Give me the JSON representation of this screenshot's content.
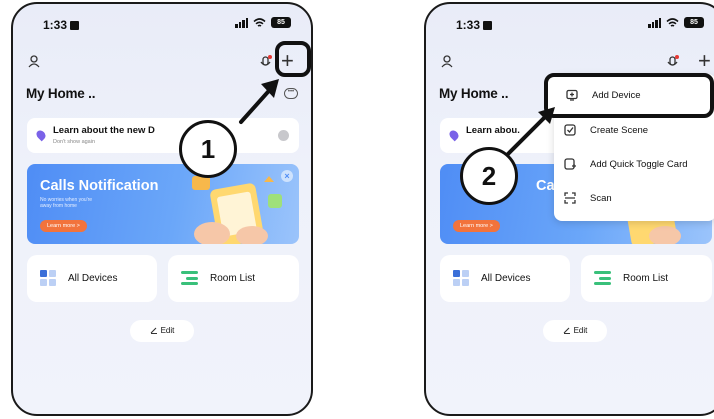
{
  "status_bar": {
    "time": "1:33",
    "battery": "85"
  },
  "home": {
    "title": "My Home ..",
    "learn_card": {
      "title": "Learn about the new D",
      "subtitle": "Don't show again",
      "title_truncated": "Learn abou."
    },
    "banner": {
      "title": "Calls Notification",
      "title_truncated": "Ca",
      "subtitle": "No worries when you're away from home",
      "button": "Learn more >"
    },
    "tiles": {
      "all_devices": "All Devices",
      "room_list": "Room List"
    },
    "edit": "Edit"
  },
  "steps": {
    "one": "1",
    "two": "2"
  },
  "dropdown_menu": {
    "items": [
      {
        "label": "Add Device",
        "icon": "add-device-icon"
      },
      {
        "label": "Create Scene",
        "icon": "scene-icon"
      },
      {
        "label": "Add Quick Toggle Card",
        "icon": "toggle-card-icon"
      },
      {
        "label": "Scan",
        "icon": "scan-icon"
      }
    ]
  },
  "colors": {
    "banner": "#5a95f6",
    "banner_button": "#f2733c",
    "accent_purple": "#7a62e8",
    "room_list_green": "#39c07a",
    "notification_dot": "#e53935"
  }
}
